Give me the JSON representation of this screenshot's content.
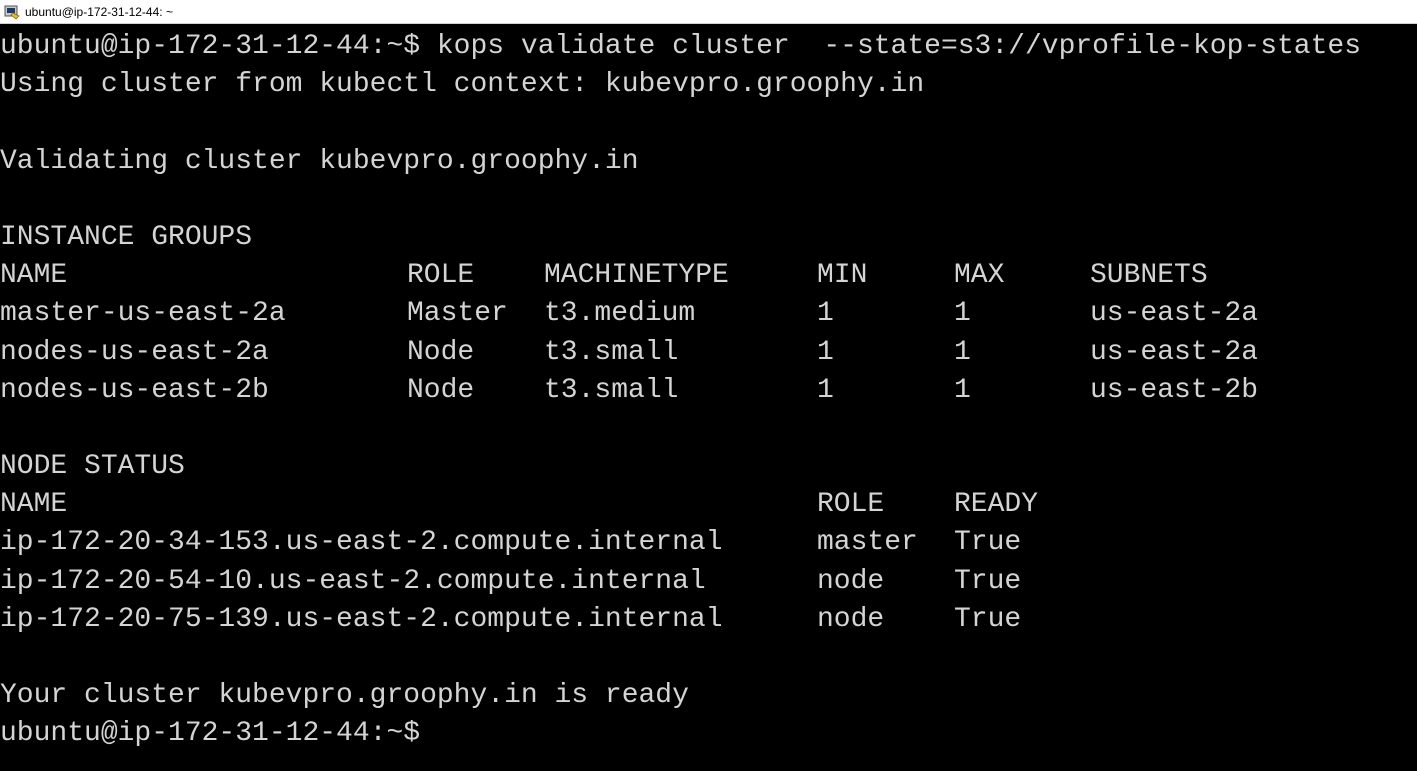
{
  "window": {
    "title": "ubuntu@ip-172-31-12-44: ~",
    "icon": "putty-terminal-icon"
  },
  "terminal": {
    "lines": [
      {
        "type": "text",
        "text": "ubuntu@ip-172-31-12-44:~$ kops validate cluster  --state=s3://vprofile-kop-states"
      },
      {
        "type": "text",
        "text": "Using cluster from kubectl context: kubevpro.groophy.in"
      },
      {
        "type": "blank",
        "text": ""
      },
      {
        "type": "text",
        "text": "Validating cluster kubevpro.groophy.in"
      },
      {
        "type": "blank",
        "text": ""
      },
      {
        "type": "text",
        "text": "INSTANCE GROUPS"
      },
      {
        "type": "ig",
        "cells": [
          "NAME",
          "ROLE",
          "MACHINETYPE",
          "MIN",
          "MAX",
          "SUBNETS"
        ]
      },
      {
        "type": "ig",
        "cells": [
          "master-us-east-2a",
          "Master",
          "t3.medium",
          "1",
          "1",
          "us-east-2a"
        ]
      },
      {
        "type": "ig",
        "cells": [
          "nodes-us-east-2a",
          "Node",
          "t3.small",
          "1",
          "1",
          "us-east-2a"
        ]
      },
      {
        "type": "ig",
        "cells": [
          "nodes-us-east-2b",
          "Node",
          "t3.small",
          "1",
          "1",
          "us-east-2b"
        ]
      },
      {
        "type": "blank",
        "text": ""
      },
      {
        "type": "text",
        "text": "NODE STATUS"
      },
      {
        "type": "ns",
        "cells": [
          "NAME",
          "ROLE",
          "READY"
        ]
      },
      {
        "type": "ns",
        "cells": [
          "ip-172-20-34-153.us-east-2.compute.internal",
          "master",
          "True"
        ]
      },
      {
        "type": "ns",
        "cells": [
          "ip-172-20-54-10.us-east-2.compute.internal",
          "node",
          "True"
        ]
      },
      {
        "type": "ns",
        "cells": [
          "ip-172-20-75-139.us-east-2.compute.internal",
          "node",
          "True"
        ]
      },
      {
        "type": "blank",
        "text": ""
      },
      {
        "type": "text",
        "text": "Your cluster kubevpro.groophy.in is ready"
      },
      {
        "type": "text",
        "text": "ubuntu@ip-172-31-12-44:~$"
      }
    ]
  },
  "colors": {
    "background": "#000000",
    "foreground": "#d4d4d4",
    "titlebar": "#ffffff"
  }
}
